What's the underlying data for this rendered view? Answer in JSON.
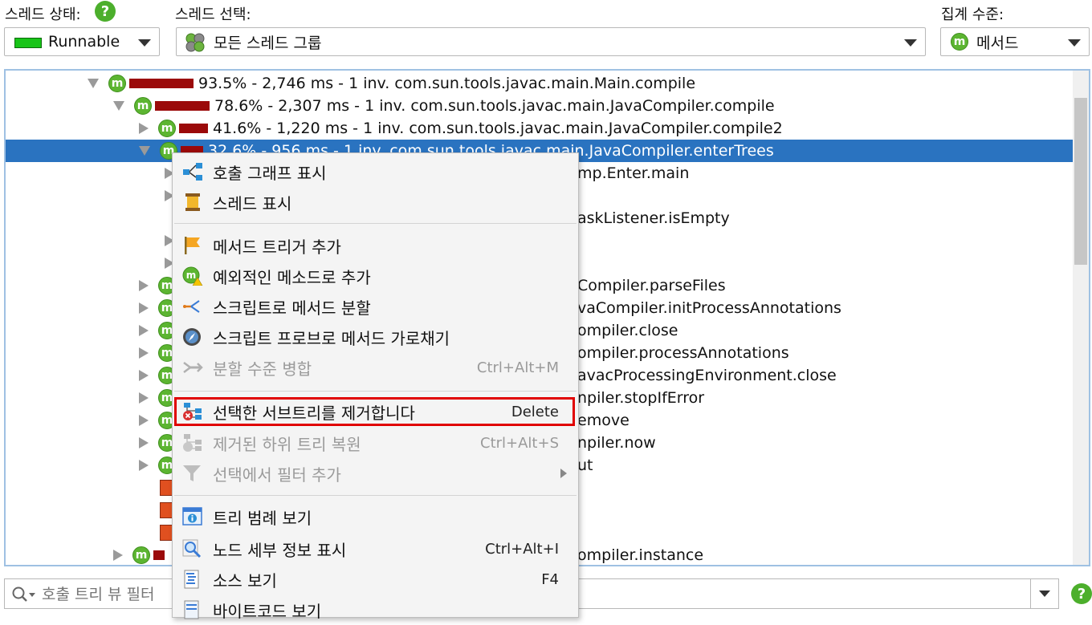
{
  "header": {
    "thread_state_label": "스레드 상태:",
    "thread_select_label": "스레드 선택:",
    "aggregation_label": "집계 수준:",
    "thread_state_value": "Runnable",
    "thread_select_value": "모든 스레드 그룹",
    "aggregation_value": "메서드"
  },
  "tree": {
    "rows": [
      {
        "text": "93.5% - 2,746 ms - 1 inv. com.sun.tools.javac.main.Main.compile"
      },
      {
        "text": "78.6% - 2,307 ms - 1 inv. com.sun.tools.javac.main.JavaCompiler.compile"
      },
      {
        "text": "41.6% - 1,220 ms - 1 inv. com.sun.tools.javac.main.JavaCompiler.compile2"
      },
      {
        "text": "32.6% - 956 ms - 1 inv. com.sun.tools.javac.main.JavaCompiler.enterTrees"
      },
      {
        "text": "mp.Enter.main"
      },
      {
        "text": "askListener.isEmpty"
      },
      {
        "text": "Compiler.parseFiles"
      },
      {
        "text": "vaCompiler.initProcessAnnotations"
      },
      {
        "text": "ompiler.close"
      },
      {
        "text": "ompiler.processAnnotations"
      },
      {
        "text": "avacProcessingEnvironment.close"
      },
      {
        "text": "npiler.stopIfError"
      },
      {
        "text": "emove"
      },
      {
        "text": "npiler.now"
      },
      {
        "text": "ut"
      },
      {
        "text": "ompiler.instance"
      }
    ]
  },
  "context_menu": {
    "items": [
      {
        "label": "호출 그래프 표시",
        "shortcut": ""
      },
      {
        "label": "스레드 표시",
        "shortcut": ""
      },
      {
        "label": "메서드 트리거 추가",
        "shortcut": ""
      },
      {
        "label": "예외적인 메소드로 추가",
        "shortcut": ""
      },
      {
        "label": "스크립트로 메서드 분할",
        "shortcut": ""
      },
      {
        "label": "스크립트 프로브로 메서드 가로채기",
        "shortcut": ""
      },
      {
        "label": "분할 수준 병합",
        "shortcut": "Ctrl+Alt+M"
      },
      {
        "label": "선택한 서브트리를 제거합니다",
        "shortcut": "Delete"
      },
      {
        "label": "제거된 하위 트리 복원",
        "shortcut": "Ctrl+Alt+S"
      },
      {
        "label": "선택에서 필터 추가",
        "shortcut": ""
      },
      {
        "label": "트리 범례 보기",
        "shortcut": ""
      },
      {
        "label": "노드 세부 정보 표시",
        "shortcut": "Ctrl+Alt+I"
      },
      {
        "label": "소스 보기",
        "shortcut": "F4"
      },
      {
        "label": "바이트코드 보기",
        "shortcut": ""
      }
    ]
  },
  "filter": {
    "placeholder": "호출 트리 뷰 필터"
  },
  "colors": {
    "selection": "#2a73c0",
    "bar": "#9b0a0a",
    "highlight_box": "#e00000",
    "method_icon": "#5cb531"
  }
}
